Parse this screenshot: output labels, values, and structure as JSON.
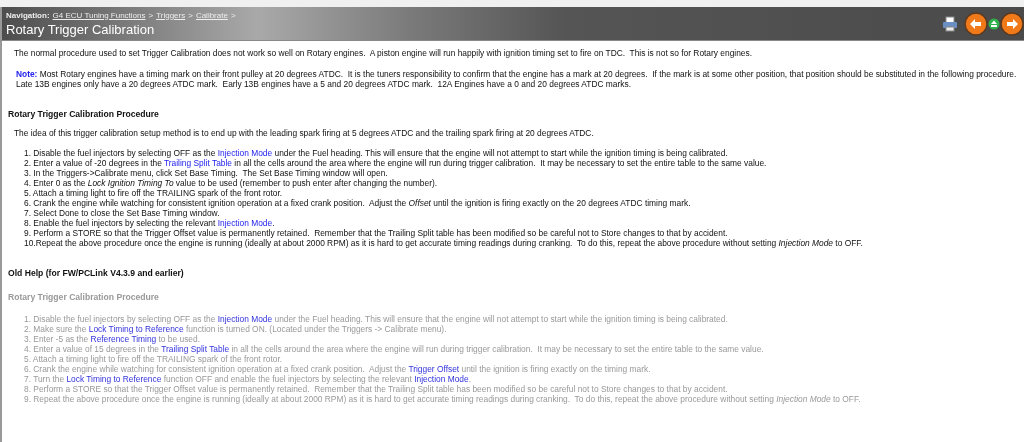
{
  "navigation": {
    "label": "Navigation:",
    "crumbs": [
      "G4 ECU Tuning Functions",
      "Triggers",
      "Calibrate"
    ],
    "separator": ">"
  },
  "title": "Rotary Trigger Calibration",
  "intro": "The normal procedure used to set Trigger Calibration does not work so well on Rotary engines.  A piston engine will run happily with ignition timing set to fire on TDC.  This is not so for Rotary engines.",
  "note": {
    "label": "Note:",
    "text": "Most Rotary engines have a timing mark on their front pulley at 20 degrees ATDC.  It is the tuners responsibility to confirm that the engine has a mark at 20 degrees.  If the mark is at some other position, that position should be substituted in the following procedure.  Late 13B engines only have a 20 degrees ATDC mark.  Early 13B engines have a 5 and 20 degrees ATDC mark.  12A Engines have a 0 and 20 degrees ATDC marks."
  },
  "sections": [
    {
      "heading": "Rotary Trigger Calibration Procedure",
      "old": false,
      "lead": "The idea of this trigger calibration setup method is to end up with the leading spark firing at 5 degrees ATDC and the trailing spark firing at 20 degrees ATDC.",
      "steps": [
        [
          {
            "kind": "plain",
            "text": "1. Disable the fuel injectors by selecting OFF as the "
          },
          {
            "kind": "link",
            "text": "Injection Mode"
          },
          {
            "kind": "plain",
            "text": " under the Fuel heading. This will ensure that the engine will not attempt to start while the ignition timing is being calibrated."
          }
        ],
        [
          {
            "kind": "plain",
            "text": "2. Enter a value of -20 degrees in the "
          },
          {
            "kind": "link",
            "text": "Trailing Split Table"
          },
          {
            "kind": "plain",
            "text": " in all the cells around the area where the engine will run during trigger calibration.  It may be necessary to set the entire table to the same value."
          }
        ],
        [
          {
            "kind": "plain",
            "text": "3. In the Triggers->Calibrate menu, click Set Base Timing.  The Set Base Timing window will open."
          }
        ],
        [
          {
            "kind": "plain",
            "text": "4. Enter 0 as the "
          },
          {
            "kind": "italic",
            "text": "Lock Ignition Timing To"
          },
          {
            "kind": "plain",
            "text": " value to be used (remember to push enter after changing the number)."
          }
        ],
        [
          {
            "kind": "plain",
            "text": "5. Attach a timing light to fire off the TRAILING spark of the front rotor."
          }
        ],
        [
          {
            "kind": "plain",
            "text": "6. Crank the engine while watching for consistent ignition operation at a fixed crank position.  Adjust the "
          },
          {
            "kind": "italic",
            "text": "Offset"
          },
          {
            "kind": "plain",
            "text": " until the ignition is firing exactly on the 20 degrees ATDC timing mark."
          }
        ],
        [
          {
            "kind": "plain",
            "text": "7. Select Done to close the Set Base Timing window."
          }
        ],
        [
          {
            "kind": "plain",
            "text": "8. Enable the fuel injectors by selecting the relevant "
          },
          {
            "kind": "link",
            "text": "Injection Mode"
          },
          {
            "kind": "plain",
            "text": "."
          }
        ],
        [
          {
            "kind": "plain",
            "text": "9. Perform a STORE so that the Trigger Offset value is permanently retained.  Remember that the Trailing Split table has been modified so be careful not to Store changes to that by accident."
          }
        ],
        [
          {
            "kind": "plain",
            "text": "10.Repeat the above procedure once the engine is running (ideally at about 2000 RPM) as it is hard to get accurate timing readings during cranking.  To do this, repeat the above procedure without setting "
          },
          {
            "kind": "italic",
            "text": "Injection Mode"
          },
          {
            "kind": "plain",
            "text": " to OFF."
          }
        ]
      ]
    },
    {
      "supertitle": "Old Help (for FW/PCLink V4.3.9 and earlier)",
      "heading": "Rotary Trigger Calibration Procedure",
      "old": true,
      "steps": [
        [
          {
            "kind": "plain",
            "text": "1. Disable the fuel injectors by selecting OFF as the "
          },
          {
            "kind": "link",
            "text": "Injection Mode"
          },
          {
            "kind": "plain",
            "text": " under the Fuel heading. This will ensure that the engine will not attempt to start while the ignition timing is being calibrated."
          }
        ],
        [
          {
            "kind": "plain",
            "text": "2. Make sure the "
          },
          {
            "kind": "link",
            "text": "Lock Timing to Reference"
          },
          {
            "kind": "plain",
            "text": " function is turned ON. (Located under the Triggers -> Calibrate menu)."
          }
        ],
        [
          {
            "kind": "plain",
            "text": "3. Enter -5 as the "
          },
          {
            "kind": "link",
            "text": "Reference Timing"
          },
          {
            "kind": "plain",
            "text": " to be used."
          }
        ],
        [
          {
            "kind": "plain",
            "text": "4. Enter a value of 15 degrees in the "
          },
          {
            "kind": "link",
            "text": "Trailing Split Table"
          },
          {
            "kind": "plain",
            "text": " in all the cells around the area where the engine will run during trigger calibration.  It may be necessary to set the entire table to the same value."
          }
        ],
        [
          {
            "kind": "plain",
            "text": "5. Attach a timing light to fire off the TRAILING spark of the front rotor."
          }
        ],
        [
          {
            "kind": "plain",
            "text": "6. Crank the engine while watching for consistent ignition operation at a fixed crank position.  Adjust the "
          },
          {
            "kind": "link",
            "text": "Trigger Offset"
          },
          {
            "kind": "plain",
            "text": " until the ignition is firing exactly on the timing mark."
          }
        ],
        [
          {
            "kind": "plain",
            "text": "7. Turn the "
          },
          {
            "kind": "link",
            "text": "Lock Timing to Reference"
          },
          {
            "kind": "plain",
            "text": " function OFF and enable the fuel injectors by selecting the relevant "
          },
          {
            "kind": "link",
            "text": "Injection Mode"
          },
          {
            "kind": "plain",
            "text": "."
          }
        ],
        [
          {
            "kind": "plain",
            "text": "8. Perform a STORE so that the Trigger Offset value is permanently retained.  Remember that the Trailing Split table has been modified so be careful not to Store changes to that by accident."
          }
        ],
        [
          {
            "kind": "plain",
            "text": "9. Repeat the above procedure once the engine is running (ideally at about 2000 RPM) as it is hard to get accurate timing readings during cranking.  To do this, repeat the above procedure without setting "
          },
          {
            "kind": "italic",
            "text": "Injection Mode"
          },
          {
            "kind": "plain",
            "text": " to OFF."
          }
        ]
      ]
    }
  ]
}
